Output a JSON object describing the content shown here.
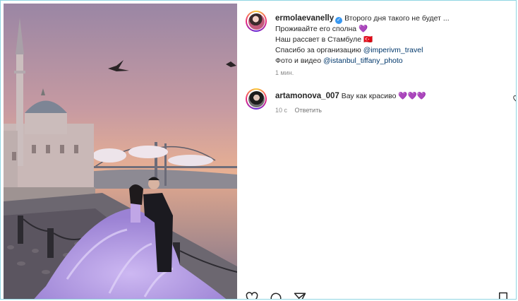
{
  "post": {
    "username": "ermolaevanelly",
    "caption_lines": [
      "Второго дня такого не будет ...",
      "Проживайте его сполна 💜",
      "Наш рассвет в Стамбуле 🇹🇷",
      "Спасибо за организацию",
      "Фото и видео"
    ],
    "mention_1": "@imperivm_travel",
    "mention_2": "@istanbul_tiffany_photo",
    "time_ago": "1 мин."
  },
  "comment": {
    "username": "artamonova_007",
    "text": "Вау как красиво 💜💜💜",
    "time_ago": "10 с",
    "reply_label": "Ответить"
  },
  "icons": {
    "verified": "verified-badge-icon",
    "like": "heart-outline-icon",
    "comment": "comment-icon",
    "share": "share-icon",
    "save": "bookmark-icon"
  },
  "colors": {
    "accent_blue": "#3897f0",
    "mention_color": "#00376b",
    "dress": "#b79ae6",
    "sky_top": "#9a86a4",
    "sky_bottom": "#f3b88b"
  }
}
